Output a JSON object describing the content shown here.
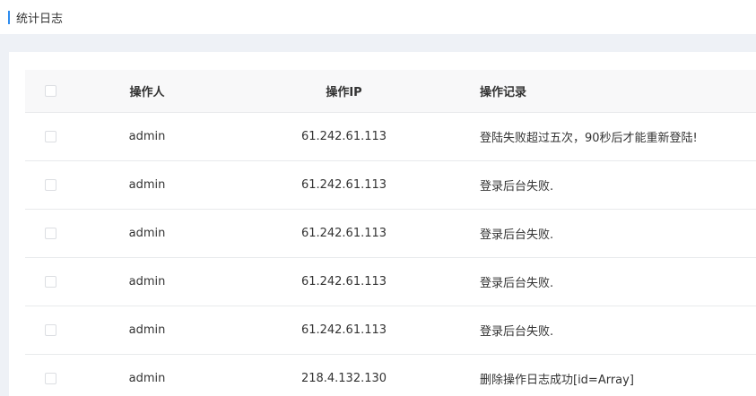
{
  "header": {
    "title": "统计日志",
    "accent_color": "#2d8cf0"
  },
  "table": {
    "columns": {
      "operator": "操作人",
      "ip": "操作IP",
      "record": "操作记录"
    },
    "rows": [
      {
        "operator": "admin",
        "ip": "61.242.61.113",
        "record": "登陆失败超过五次，90秒后才能重新登陆!"
      },
      {
        "operator": "admin",
        "ip": "61.242.61.113",
        "record": "登录后台失败."
      },
      {
        "operator": "admin",
        "ip": "61.242.61.113",
        "record": "登录后台失败."
      },
      {
        "operator": "admin",
        "ip": "61.242.61.113",
        "record": "登录后台失败."
      },
      {
        "operator": "admin",
        "ip": "61.242.61.113",
        "record": "登录后台失败."
      },
      {
        "operator": "admin",
        "ip": "218.4.132.130",
        "record": "删除操作日志成功[id=Array]"
      }
    ]
  }
}
